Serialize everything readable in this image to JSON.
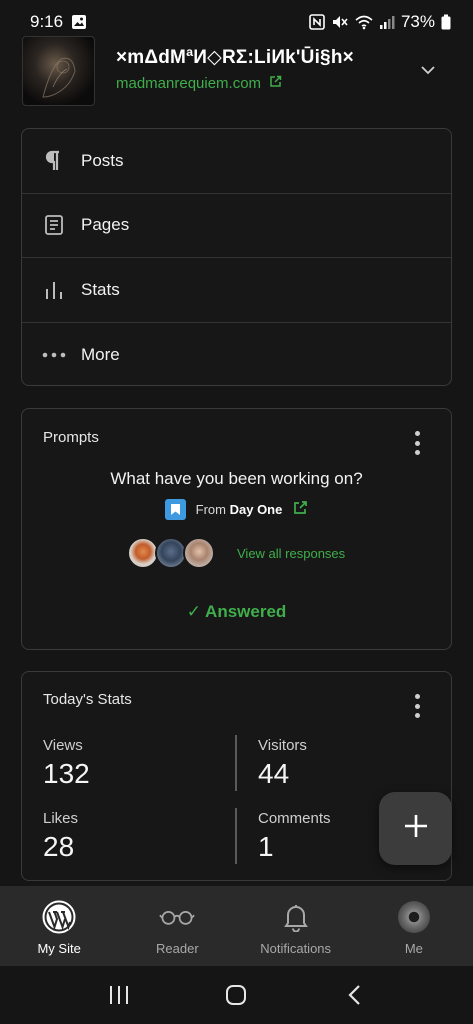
{
  "status_bar": {
    "time": "9:16",
    "battery": "73%"
  },
  "site": {
    "title": "×mΔdMªИ◇RΣ:LiИk'Ūi§h×",
    "url": "madmanrequiem.com"
  },
  "menu": {
    "items": [
      {
        "label": "Posts",
        "icon": "pilcrow-icon"
      },
      {
        "label": "Pages",
        "icon": "page-icon"
      },
      {
        "label": "Stats",
        "icon": "bar-chart-icon"
      },
      {
        "label": "More",
        "icon": "more-horizontal-icon"
      }
    ]
  },
  "prompts": {
    "title": "Prompts",
    "question": "What have you been working on?",
    "source_prefix": "From",
    "source_name": "Day One",
    "view_all": "View all responses",
    "answered": "✓ Answered"
  },
  "stats": {
    "title": "Today's Stats",
    "items": [
      {
        "label": "Views",
        "value": "132"
      },
      {
        "label": "Visitors",
        "value": "44"
      },
      {
        "label": "Likes",
        "value": "28"
      },
      {
        "label": "Comments",
        "value": "1"
      }
    ]
  },
  "bottom_nav": {
    "items": [
      {
        "label": "My Site",
        "icon": "wordpress-icon",
        "active": true
      },
      {
        "label": "Reader",
        "icon": "glasses-icon",
        "active": false
      },
      {
        "label": "Notifications",
        "icon": "bell-icon",
        "active": false
      },
      {
        "label": "Me",
        "icon": "avatar-icon",
        "active": false
      }
    ]
  },
  "colors": {
    "background": "#151515",
    "accent_green": "#3fae4b",
    "card_border": "#3a3a3a",
    "nav_background": "#2a2a2a"
  }
}
